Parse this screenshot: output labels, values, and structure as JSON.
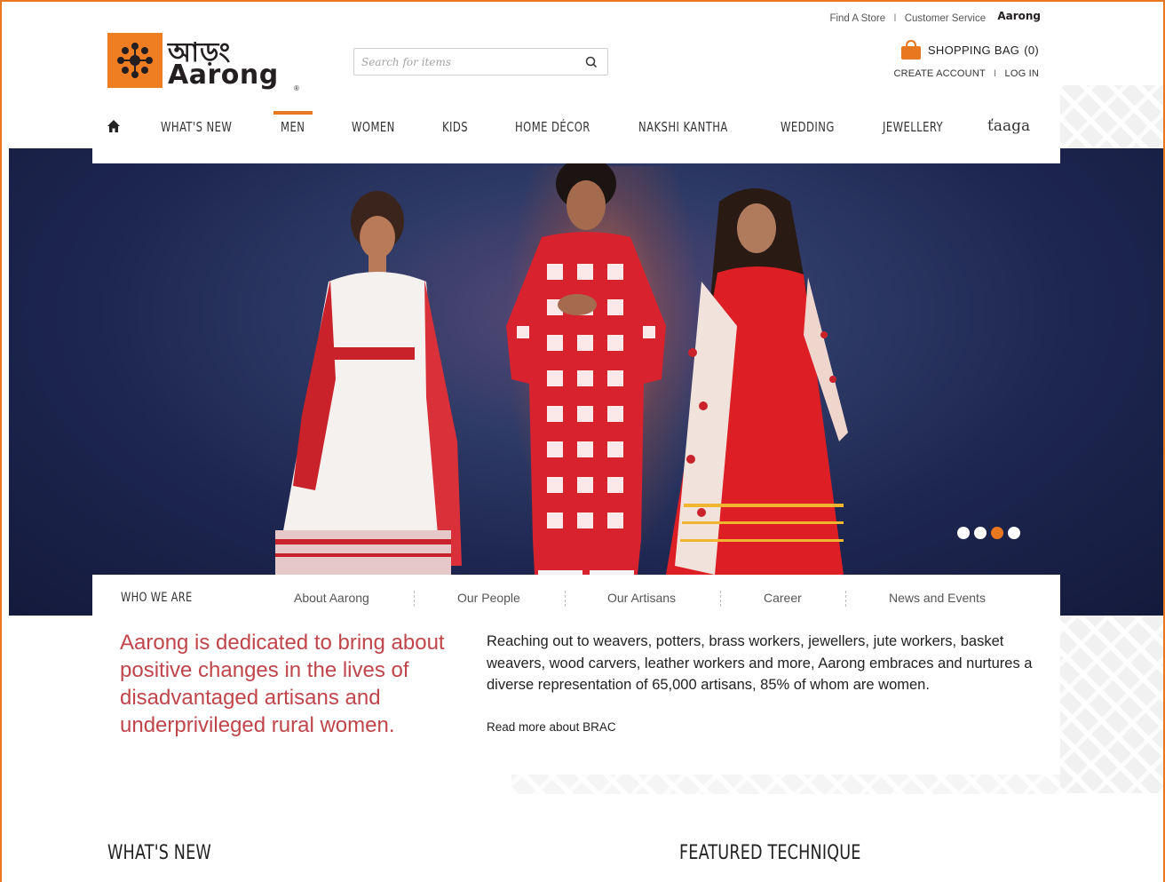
{
  "utility": {
    "find_store": "Find A Store",
    "customer_service": "Customer Service",
    "separator": "I",
    "mini_logo": "Aarong"
  },
  "brand": {
    "name_bn": "আড়ং",
    "name_en": "Aarong",
    "reg": "®",
    "accent": "#e8771f"
  },
  "search": {
    "placeholder": "Search for items"
  },
  "bag": {
    "label": "SHOPPING BAG",
    "count": "(0)"
  },
  "account": {
    "create": "CREATE ACCOUNT",
    "separator": "I",
    "login": "LOG IN"
  },
  "nav": {
    "items": [
      "WHAT'S NEW",
      "MEN",
      "WOMEN",
      "KIDS",
      "HOME DÉCOR",
      "NAKSHI KANTHA",
      "WEDDING",
      "JEWELLERY"
    ],
    "active": "MEN",
    "taaga": "ťaaga"
  },
  "carousel": {
    "slide_count": 4,
    "active_index": 2
  },
  "subnav": {
    "title": "WHO WE ARE",
    "links": [
      "About Aarong",
      "Our People",
      "Our Artisans",
      "Career",
      "News and Events"
    ]
  },
  "mission": "Aarong is dedicated to bring about positive changes in the lives of disadvantaged artisans and underprivileged rural women.",
  "about": "Reaching out to weavers, potters, brass workers, jewellers, jute workers, basket weavers, wood carvers, leather workers and more, Aarong embraces and nurtures a diverse representation of 65,000 artisans, 85% of whom are women.",
  "read_more": "Read more about BRAC",
  "sections": {
    "whats_new": "WHAT'S NEW",
    "featured": "FEATURED TECHNIQUE"
  }
}
